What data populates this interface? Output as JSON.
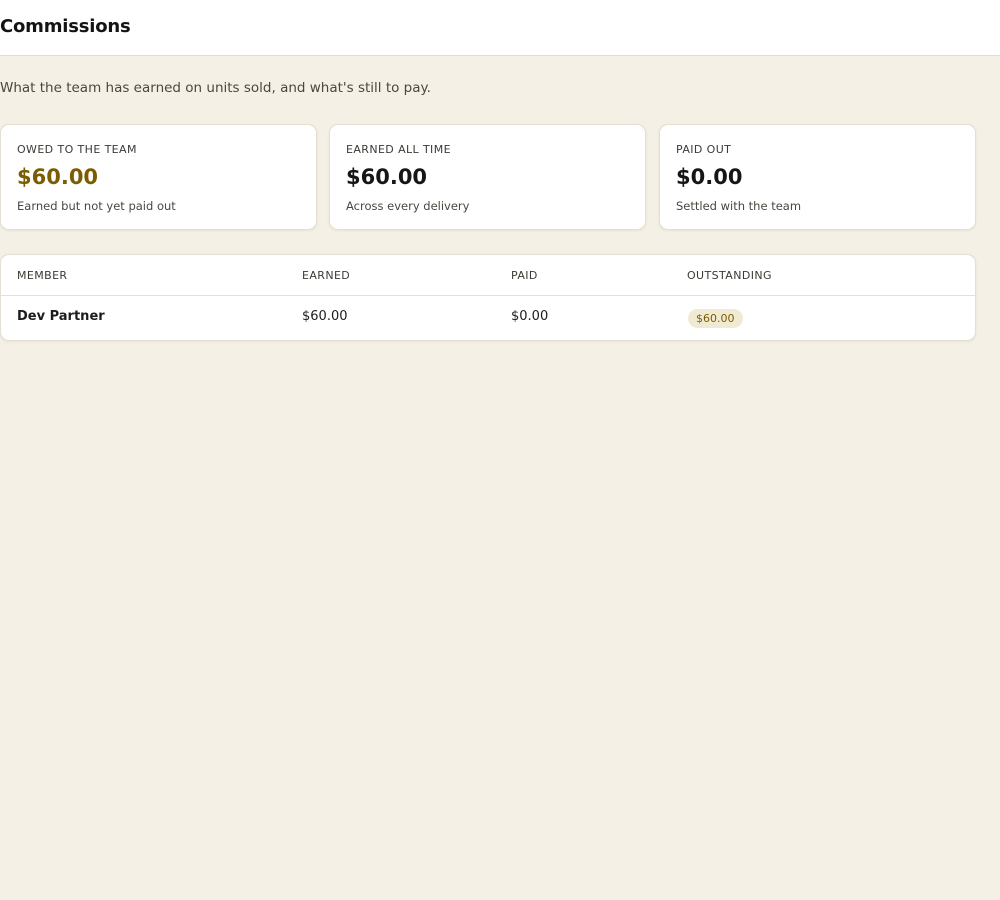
{
  "header": {
    "title": "Commissions"
  },
  "subtitle": "What the team has earned on units sold, and what's still to pay.",
  "cards": [
    {
      "label": "OWED TO THE TEAM",
      "value": "$60.00",
      "note": "Earned but not yet paid out"
    },
    {
      "label": "EARNED ALL TIME",
      "value": "$60.00",
      "note": "Across every delivery"
    },
    {
      "label": "PAID OUT",
      "value": "$0.00",
      "note": "Settled with the team"
    }
  ],
  "table": {
    "columns": [
      "MEMBER",
      "EARNED",
      "PAID",
      "OUTSTANDING"
    ],
    "rows": [
      {
        "member": "Dev Partner",
        "earned": "$60.00",
        "paid": "$0.00",
        "outstanding": "$60.00"
      }
    ]
  },
  "colors": {
    "background": "#f4f0e5",
    "accent": "#7a5d00",
    "badge_bg": "#f1ead3"
  }
}
